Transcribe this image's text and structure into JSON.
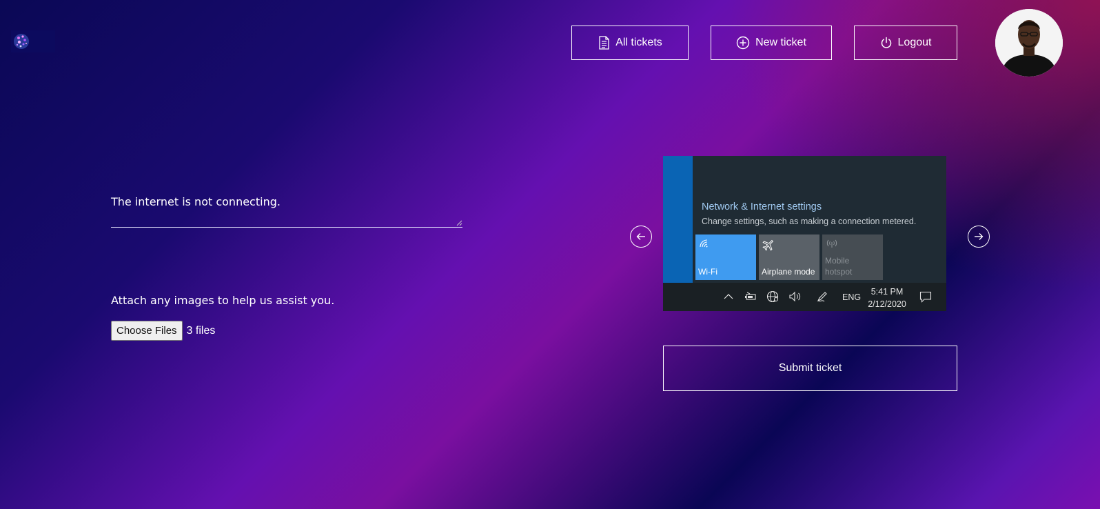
{
  "header": {
    "logo_alt": "logo",
    "nav": {
      "all_tickets": "All tickets",
      "new_ticket": "New ticket",
      "logout": "Logout"
    },
    "icons": {
      "all_tickets": "document-icon",
      "new_ticket": "plus-circle-icon",
      "logout": "power-icon"
    }
  },
  "form": {
    "description_value": "The internet is not connecting.",
    "attach_label": "Attach any images to help us assist you.",
    "choose_files_label": "Choose Files",
    "file_count": "3 files",
    "submit_label": "Submit ticket"
  },
  "carousel": {
    "screenshot": {
      "title": "Network & Internet settings",
      "subtitle": "Change settings, such as making a connection metered.",
      "tiles": [
        {
          "label": "Wi-Fi",
          "icon": "wifi-icon"
        },
        {
          "label": "Airplane mode",
          "icon": "airplane-icon"
        },
        {
          "label": "Mobile\nhotspot",
          "icon": "hotspot-icon"
        }
      ],
      "taskbar": {
        "lang": "ENG",
        "time": "5:41 PM",
        "date": "2/12/2020"
      }
    }
  },
  "colors": {
    "tile_wifi": "#3f9bf0",
    "tile_inactive": "#5a6168",
    "screenshot_bg": "#1f2b34",
    "accent_strip": "#0a64b4"
  }
}
